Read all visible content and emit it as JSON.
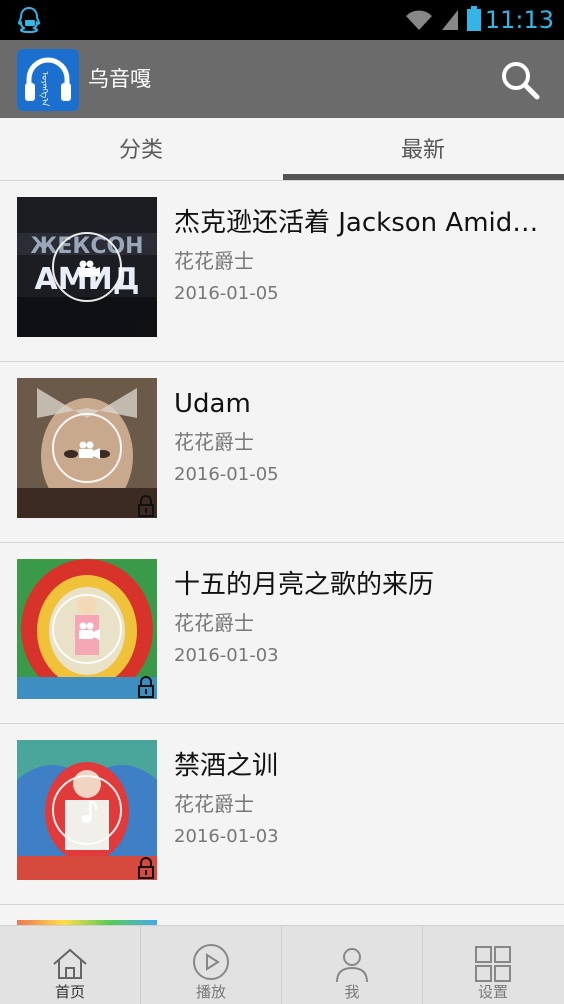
{
  "status": {
    "time": "11:13",
    "accent": "#33b5e5"
  },
  "app": {
    "title": "乌音嘎",
    "logo_icon": "headphones-icon",
    "search_icon": "search-icon"
  },
  "tabs": [
    {
      "label": "分类",
      "active": false
    },
    {
      "label": "最新",
      "active": true
    }
  ],
  "items": [
    {
      "title": "杰克逊还活着 Jackson Amid…",
      "author": "花花爵士",
      "date": "2016-01-05",
      "media": "video",
      "locked": true
    },
    {
      "title": "Udam",
      "author": "花花爵士",
      "date": "2016-01-05",
      "media": "video",
      "locked": true
    },
    {
      "title": "十五的月亮之歌的来历",
      "author": "花花爵士",
      "date": "2016-01-03",
      "media": "video",
      "locked": true
    },
    {
      "title": "禁酒之训",
      "author": "花花爵士",
      "date": "2016-01-03",
      "media": "audio",
      "locked": true
    }
  ],
  "nav": [
    {
      "label": "首页",
      "icon": "home-icon",
      "active": true
    },
    {
      "label": "播放",
      "icon": "play-icon",
      "active": false
    },
    {
      "label": "我",
      "icon": "user-icon",
      "active": false
    },
    {
      "label": "设置",
      "icon": "grid-icon",
      "active": false
    }
  ]
}
